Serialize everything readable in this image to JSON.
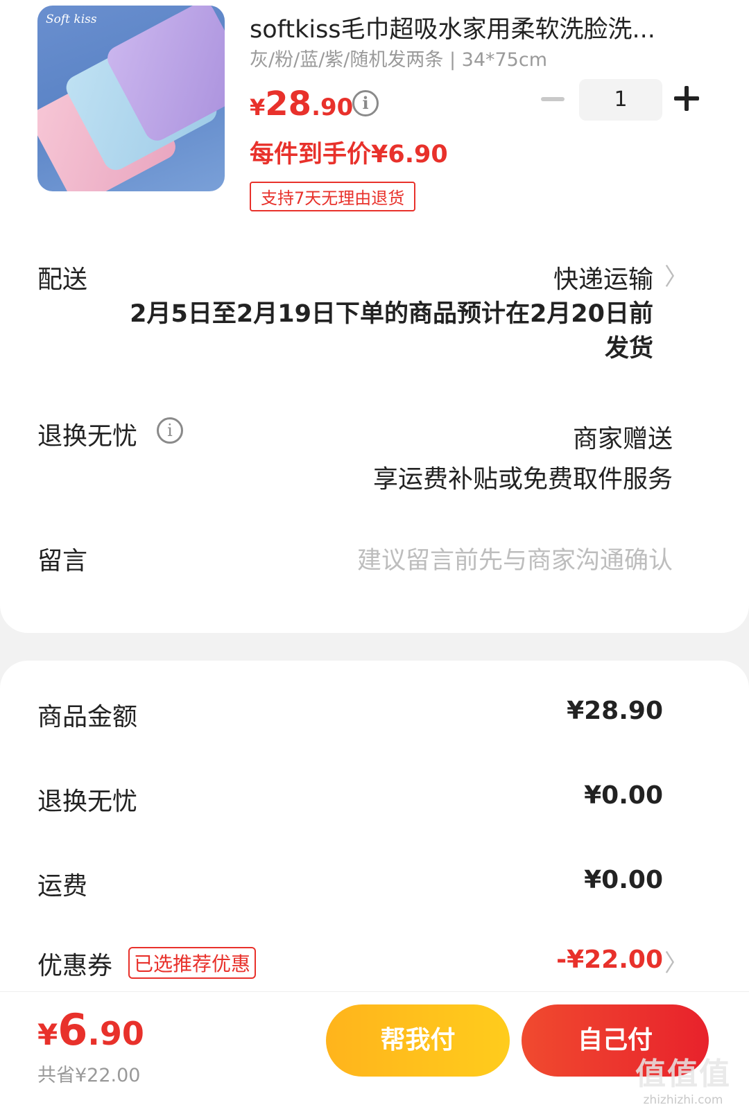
{
  "product": {
    "logo_text": "Soft kiss",
    "title": "softkiss毛巾超吸水家用柔软洗脸洗...",
    "spec": "灰/粉/蓝/紫/随机发两条 | 34*75cm",
    "price_symbol": "¥",
    "price_int": "28",
    "price_dec": ".90",
    "info_glyph": "i",
    "unit_price": "每件到手价¥6.90",
    "badge": "支持7天无理由退货",
    "quantity": "1"
  },
  "delivery": {
    "label": "配送",
    "method": "快递运输",
    "note": "2月5日至2月19日下单的商品预计在2月20日前发货",
    "chevron": "〉"
  },
  "returns": {
    "label": "退换无忧",
    "info_glyph": "i",
    "value_line1": "商家赠送",
    "value_line2": "享运费补贴或免费取件服务"
  },
  "message": {
    "label": "留言",
    "placeholder": "建议留言前先与商家沟通确认"
  },
  "summary": {
    "goods_label": "商品金额",
    "goods_value": "¥28.90",
    "returns_label": "退换无忧",
    "returns_value": "¥0.00",
    "shipping_label": "运费",
    "shipping_value": "¥0.00",
    "coupon_label": "优惠券",
    "coupon_badge": "已选推荐优惠",
    "coupon_value": "-¥22.00",
    "chevron": "〉"
  },
  "bottom": {
    "total_symbol": "¥",
    "total_int": "6",
    "total_dec": ".90",
    "saved": "共省¥22.00",
    "help_pay": "帮我付",
    "self_pay": "自己付",
    "watermark_big": "值值值",
    "watermark_small": "zhizhizhi.com"
  },
  "colors": {
    "accent_red": "#e8312b",
    "accent_yellow": "#ffb41c"
  }
}
